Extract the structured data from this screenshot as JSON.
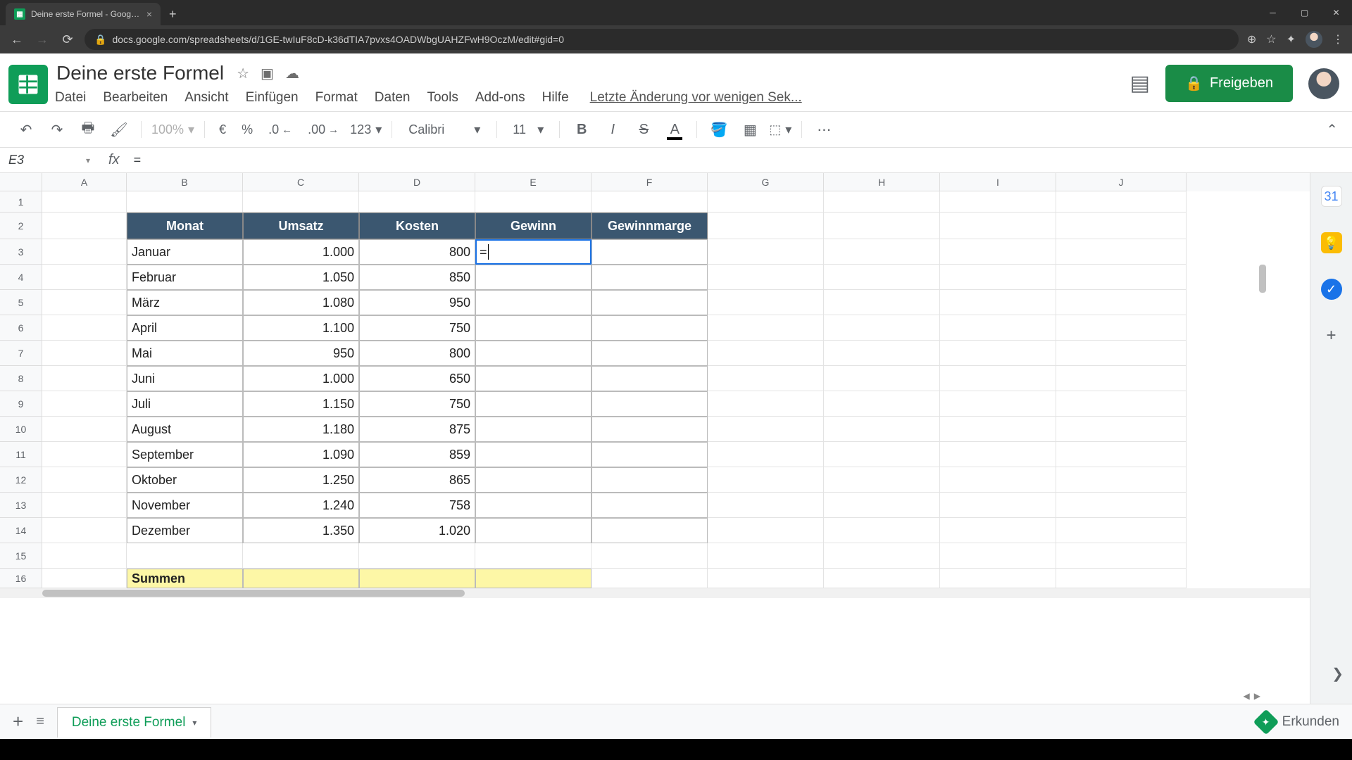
{
  "browser": {
    "tab_title": "Deine erste Formel - Google Tab",
    "url": "docs.google.com/spreadsheets/d/1GE-twIuF8cD-k36dTIA7pvxs4OADWbgUAHZFwH9OczM/edit#gid=0"
  },
  "doc": {
    "title": "Deine erste Formel",
    "last_edit": "Letzte Änderung vor wenigen Sek...",
    "share_label": "Freigeben"
  },
  "menu": {
    "file": "Datei",
    "edit": "Bearbeiten",
    "view": "Ansicht",
    "insert": "Einfügen",
    "format": "Format",
    "data": "Daten",
    "tools": "Tools",
    "addons": "Add-ons",
    "help": "Hilfe"
  },
  "toolbar": {
    "zoom": "100%",
    "currency": "€",
    "percent": "%",
    "dec_less": ".0",
    "dec_more": ".00",
    "numfmt": "123",
    "font": "Calibri",
    "size": "11"
  },
  "formula_bar": {
    "name_box": "E3",
    "fx": "fx",
    "value": "="
  },
  "columns": [
    "A",
    "B",
    "C",
    "D",
    "E",
    "F",
    "G",
    "H",
    "I",
    "J"
  ],
  "rows_visible": [
    "1",
    "2",
    "3",
    "4",
    "5",
    "6",
    "7",
    "8",
    "9",
    "10",
    "11",
    "12",
    "13",
    "14",
    "15",
    "16"
  ],
  "table": {
    "headers": {
      "monat": "Monat",
      "umsatz": "Umsatz",
      "kosten": "Kosten",
      "gewinn": "Gewinn",
      "marge": "Gewinnmarge"
    },
    "rows": [
      {
        "monat": "Januar",
        "umsatz": "1.000",
        "kosten": "800"
      },
      {
        "monat": "Februar",
        "umsatz": "1.050",
        "kosten": "850"
      },
      {
        "monat": "März",
        "umsatz": "1.080",
        "kosten": "950"
      },
      {
        "monat": "April",
        "umsatz": "1.100",
        "kosten": "750"
      },
      {
        "monat": "Mai",
        "umsatz": "950",
        "kosten": "800"
      },
      {
        "monat": "Juni",
        "umsatz": "1.000",
        "kosten": "650"
      },
      {
        "monat": "Juli",
        "umsatz": "1.150",
        "kosten": "750"
      },
      {
        "monat": "August",
        "umsatz": "1.180",
        "kosten": "875"
      },
      {
        "monat": "September",
        "umsatz": "1.090",
        "kosten": "859"
      },
      {
        "monat": "Oktober",
        "umsatz": "1.250",
        "kosten": "865"
      },
      {
        "monat": "November",
        "umsatz": "1.240",
        "kosten": "758"
      },
      {
        "monat": "Dezember",
        "umsatz": "1.350",
        "kosten": "1.020"
      }
    ],
    "summary_label": "Summen",
    "editing_value": "="
  },
  "sheet_tab": {
    "name": "Deine erste Formel"
  },
  "explore_label": "Erkunden",
  "side_calendar_day": "31"
}
